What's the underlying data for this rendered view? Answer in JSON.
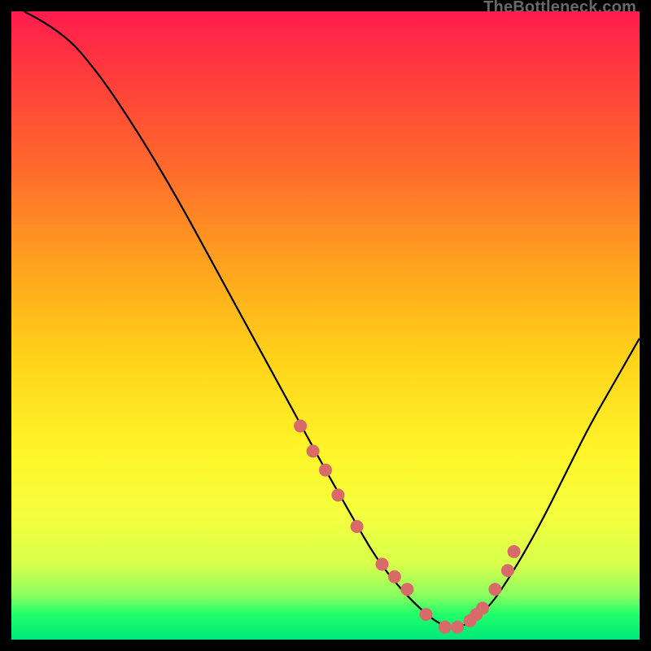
{
  "watermark": "TheBottleneck.com",
  "chart_data": {
    "type": "line",
    "title": "",
    "xlabel": "",
    "ylabel": "",
    "xlim": [
      0,
      100
    ],
    "ylim": [
      0,
      100
    ],
    "series": [
      {
        "name": "curve",
        "x": [
          2,
          8,
          14,
          20,
          26,
          32,
          38,
          44,
          50,
          54,
          58,
          62,
          66,
          69,
          72,
          76,
          80,
          84,
          88,
          92,
          96,
          100
        ],
        "y": [
          100,
          97,
          90,
          81,
          71,
          60,
          49,
          38,
          27,
          20,
          13,
          8,
          4,
          2,
          2,
          5,
          11,
          18,
          26,
          34,
          41,
          48
        ]
      }
    ],
    "markers": {
      "name": "dots",
      "x": [
        46,
        48,
        50,
        52,
        55,
        59,
        61,
        63,
        66,
        69,
        71,
        73,
        74,
        75,
        77,
        79,
        80
      ],
      "y": [
        34,
        30,
        27,
        23,
        18,
        12,
        10,
        8,
        4,
        2,
        2,
        3,
        4,
        5,
        8,
        11,
        14
      ],
      "color": "#d86a6a",
      "radius": 8
    },
    "gradient_stops": [
      {
        "pos": 0,
        "color": "#ff1b4e"
      },
      {
        "pos": 25,
        "color": "#ff6a2c"
      },
      {
        "pos": 55,
        "color": "#ffd21a"
      },
      {
        "pos": 80,
        "color": "#f5ff3e"
      },
      {
        "pos": 96,
        "color": "#1fff6a"
      },
      {
        "pos": 100,
        "color": "#00e87a"
      }
    ]
  }
}
